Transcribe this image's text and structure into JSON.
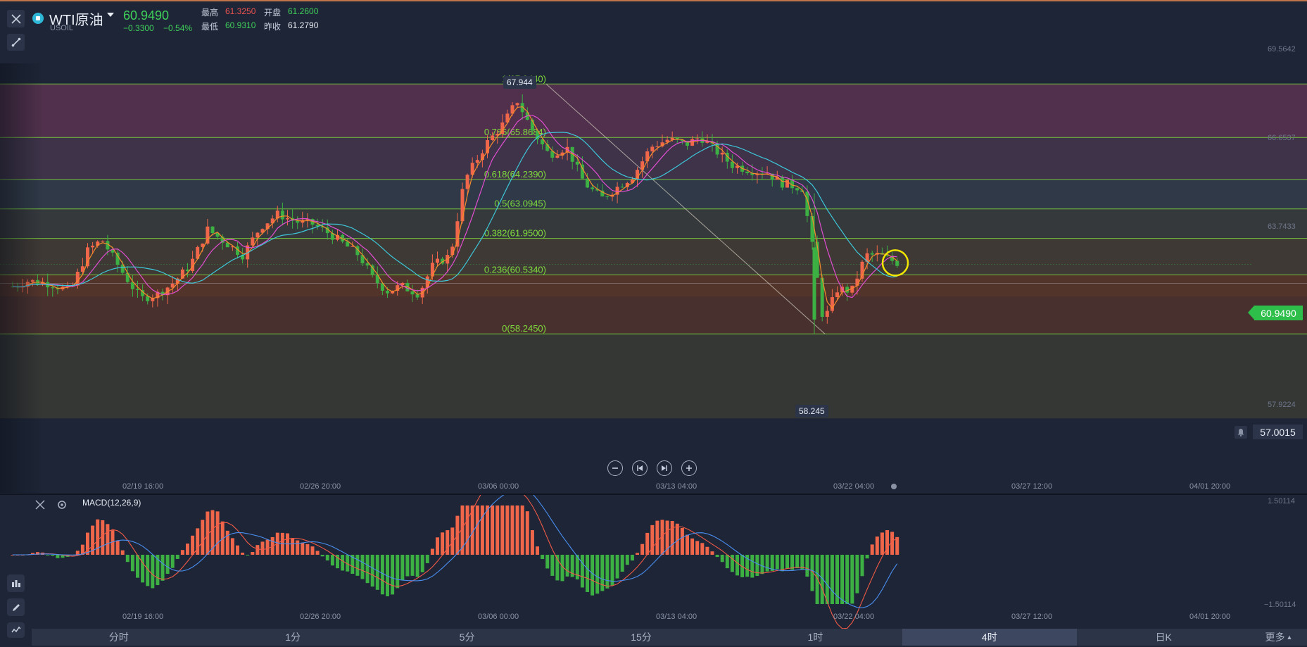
{
  "header": {
    "symbol_name": "WTI原油",
    "symbol_code": "USOIL",
    "last_price": "60.9490",
    "change": "−0.3300",
    "change_pct": "−0.54%",
    "stats": [
      {
        "label": "最高",
        "value": "61.3250",
        "color": "#ef5350"
      },
      {
        "label": "开盘",
        "value": "61.2600",
        "color": "#3fd05a"
      },
      {
        "label": "最低",
        "value": "60.9310",
        "color": "#3fd05a"
      },
      {
        "label": "昨收",
        "value": "61.2790",
        "color": "#e8ecf4"
      }
    ]
  },
  "colors": {
    "up": "#f0664a",
    "down": "#3cb043",
    "ma_fast": "#f58b2c",
    "ma_mid": "#e04dd0",
    "ma_slow": "#3dc7d9",
    "fib_line": "#7fdc3c",
    "background": "#1d2536"
  },
  "price_axis": {
    "labels": [
      "69.5642",
      "66.6537",
      "63.7433",
      "57.9224"
    ],
    "current_price_tag": "60.9490",
    "alert_price_tag": "57.0015"
  },
  "fibonacci": {
    "high_marker": "67.944",
    "low_marker": "58.245",
    "levels": [
      {
        "label": "1(67.9440)",
        "price": 67.944
      },
      {
        "label": "0.786(65.8684)",
        "price": 65.8684
      },
      {
        "label": "0.618(64.2390)",
        "price": 64.239
      },
      {
        "label": "0.5(63.0945)",
        "price": 63.0945
      },
      {
        "label": "0.382(61.9500)",
        "price": 61.95
      },
      {
        "label": "0.236(60.5340)",
        "price": 60.534
      },
      {
        "label": "0(58.2450)",
        "price": 58.245
      }
    ]
  },
  "time_axis": [
    "02/19 16:00",
    "02/26 20:00",
    "03/06 00:00",
    "03/13 04:00",
    "03/22 04:00",
    "03/27 12:00",
    "04/01 20:00"
  ],
  "macd": {
    "title": "MACD(12,26,9)",
    "axis_max": "1.50114",
    "axis_min": "−1.50114"
  },
  "timeframes": {
    "tabs": [
      "分时",
      "1分",
      "5分",
      "15分",
      "1时",
      "4时",
      "日K"
    ],
    "active": "4时",
    "more": "更多"
  }
}
